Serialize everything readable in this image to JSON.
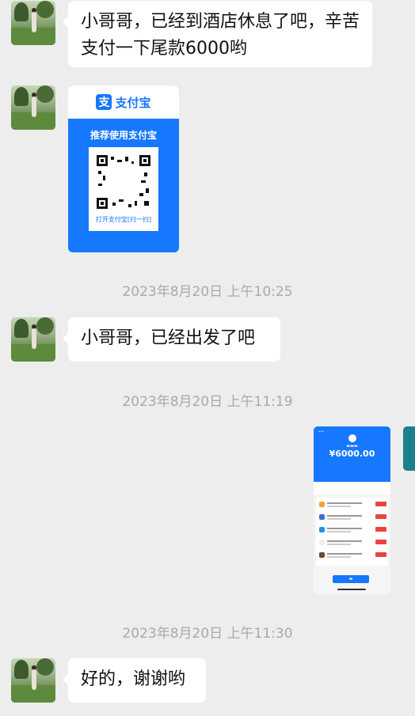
{
  "messages": [
    {
      "type": "text",
      "text": "小哥哥，已经到酒店休息了吧，辛苦支付一下尾款6000哟"
    },
    {
      "type": "alipay_card",
      "brand": "支付宝",
      "brand_icon": "支",
      "recommend": "推荐使用支付宝",
      "caption": "打开支付宝[扫一扫]"
    },
    {
      "type": "time",
      "text": "2023年8月20日 上午10:25"
    },
    {
      "type": "text",
      "text": "小哥哥，已经出发了吧"
    },
    {
      "type": "time",
      "text": "2023年8月20日 上午11:19"
    },
    {
      "type": "payment_screenshot",
      "amount": "¥6000.00"
    },
    {
      "type": "time",
      "text": "2023年8月20日 上午11:30"
    },
    {
      "type": "text",
      "text": "好的，谢谢哟"
    }
  ],
  "colors": {
    "alipay_blue": "#1677ff",
    "bg": "#ededed",
    "bubble": "#ffffff"
  }
}
